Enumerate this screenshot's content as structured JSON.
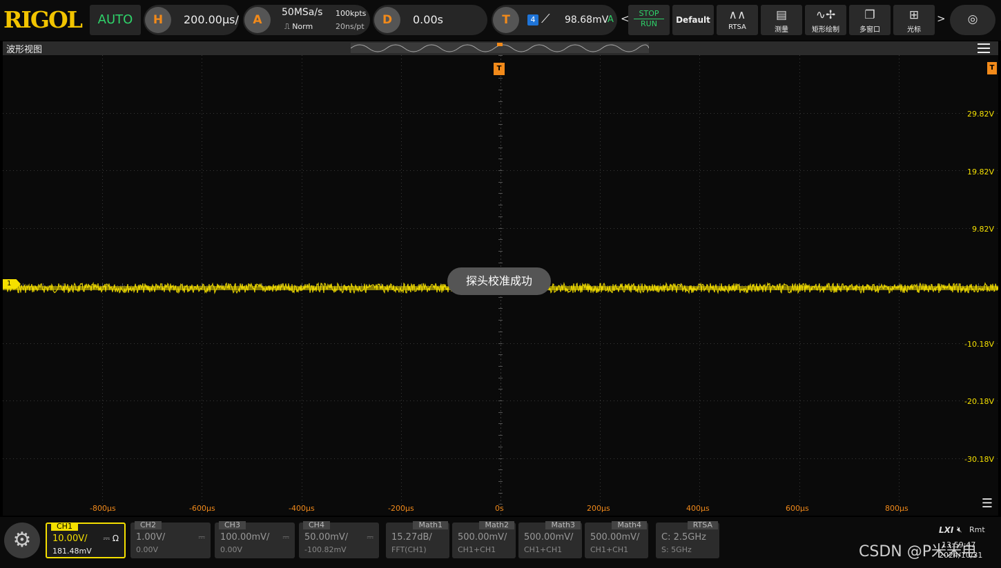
{
  "topbar": {
    "logo": "RIGOL",
    "auto": "AUTO",
    "horizontal": {
      "key": "H",
      "scale": "200.00μs/"
    },
    "acquire": {
      "key": "A",
      "rate": "50MSa/s",
      "depth": "100kpts",
      "mode": "Norm",
      "per_pt": "20ns/pt"
    },
    "delay": {
      "key": "D",
      "value": "0.00s"
    },
    "trigger": {
      "key": "T",
      "source": "4",
      "level": "98.68mV",
      "sweep": "A"
    },
    "buttons": [
      {
        "label_top": "STOP",
        "label_bottom": "RUN"
      },
      {
        "label": "Default"
      },
      {
        "label": "RTSA"
      },
      {
        "label": "测量"
      },
      {
        "label": "矩形绘制"
      },
      {
        "label": "多窗口"
      },
      {
        "label": "光标"
      }
    ]
  },
  "titlebar": {
    "title": "波形视图"
  },
  "screen": {
    "vlabels": [
      "29.82V",
      "19.82V",
      "9.82V",
      "-10.18V",
      "-20.18V",
      "-30.18V"
    ],
    "hlabels": [
      "-800μs",
      "-600μs",
      "-400μs",
      "-200μs",
      "0s",
      "200μs",
      "400μs",
      "600μs",
      "800μs"
    ],
    "toast": "探头校准成功",
    "ch1_marker": "1",
    "trigger_marker": "T"
  },
  "channels": [
    {
      "tag": "CH1",
      "scale": "10.00V/",
      "offset": "181.48mV",
      "coupling": "⎓ Ω"
    },
    {
      "tag": "CH2",
      "scale": "1.00V/",
      "offset": "0.00V",
      "coupling": "⎓"
    },
    {
      "tag": "CH3",
      "scale": "100.00mV/",
      "offset": "0.00V",
      "coupling": "⎓"
    },
    {
      "tag": "CH4",
      "scale": "50.00mV/",
      "offset": "-100.82mV",
      "coupling": "⎓"
    },
    {
      "tag": "Math1",
      "scale": "15.27dB/",
      "offset": "FFT(CH1)"
    },
    {
      "tag": "Math2",
      "scale": "500.00mV/",
      "offset": "CH1+CH1"
    },
    {
      "tag": "Math3",
      "scale": "500.00mV/",
      "offset": "CH1+CH1"
    },
    {
      "tag": "Math4",
      "scale": "500.00mV/",
      "offset": "CH1+CH1"
    },
    {
      "tag": "RTSA",
      "scale": "C: 2.5GHz",
      "offset": "S: 5GHz"
    }
  ],
  "status": {
    "lxi": "LXI",
    "rmt": "Rmt",
    "time": "13:59:47",
    "date": "2024/10/31"
  },
  "watermark": "CSDN @P米米电",
  "colors": {
    "ch1": "#f5e000",
    "trigger": "#f28a1a",
    "accent_green": "#2fd36a"
  }
}
